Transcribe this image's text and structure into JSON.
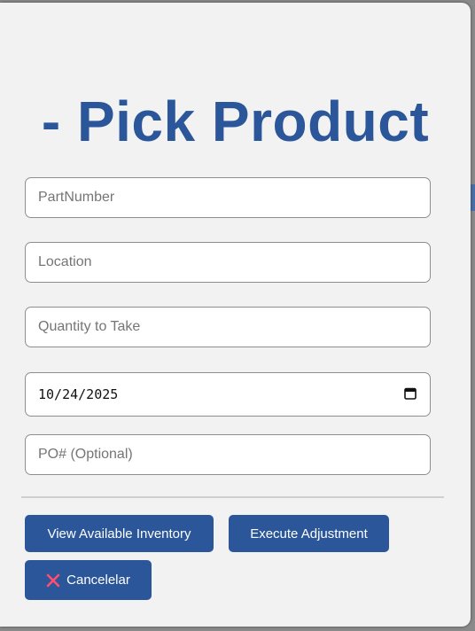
{
  "dialog": {
    "title": "- Pick Product"
  },
  "fields": {
    "part_number": {
      "placeholder": "PartNumber",
      "value": ""
    },
    "location": {
      "placeholder": "Location",
      "value": ""
    },
    "quantity": {
      "placeholder": "Quantity to Take",
      "value": ""
    },
    "date": {
      "value": "10/24/2025",
      "icon": "calendar-icon"
    },
    "po_number": {
      "placeholder": "PO# (Optional)",
      "value": ""
    }
  },
  "buttons": {
    "view_inventory": "View Available Inventory",
    "execute_adjustment": "Execute Adjustment",
    "cancel": "Cancelelar",
    "cancel_icon": "close-icon"
  },
  "colors": {
    "primary": "#2b5699",
    "cancel_icon": "#ff4f6d",
    "dialog_bg": "#f2f2f2"
  }
}
